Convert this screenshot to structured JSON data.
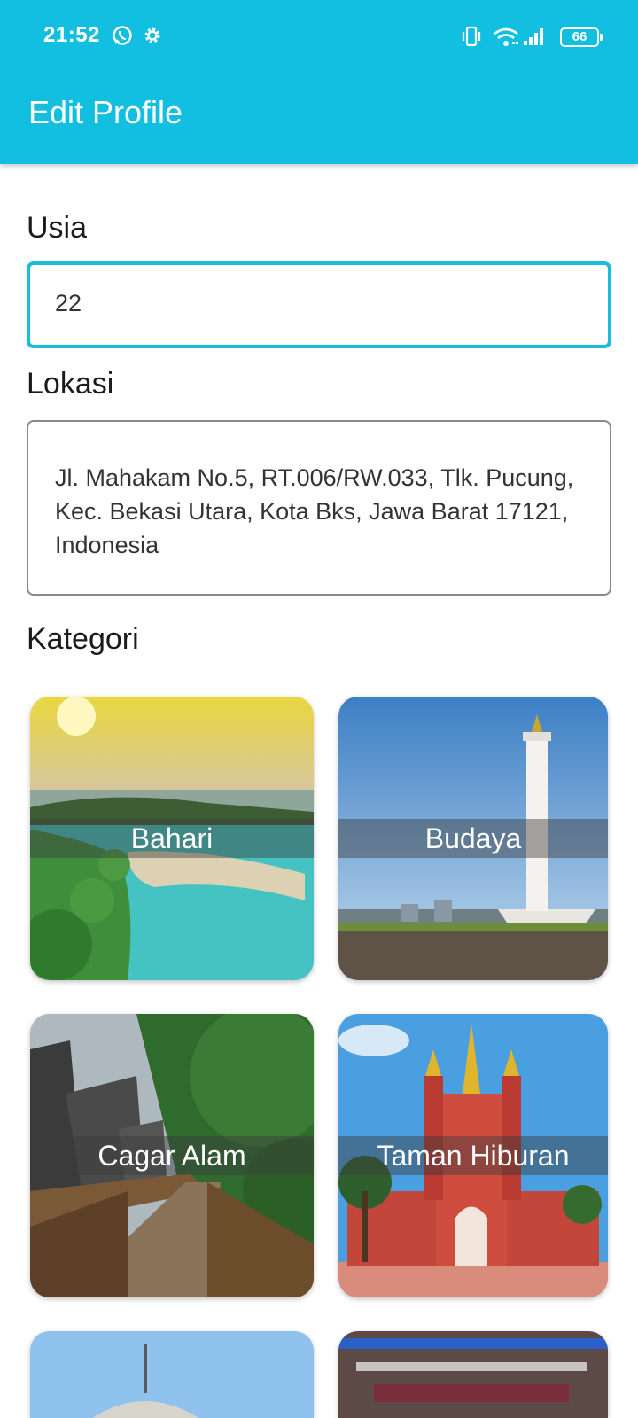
{
  "status_bar": {
    "time": "21:52",
    "battery": "66",
    "icons": [
      "whatsapp-icon",
      "settings-icon",
      "vibrate-icon",
      "wifi-icon",
      "signal-icon",
      "battery-icon"
    ]
  },
  "app_bar": {
    "title": "Edit Profile"
  },
  "form": {
    "age_label": "Usia",
    "age_value": "22",
    "location_label": "Lokasi",
    "location_value": "Jl. Mahakam No.5, RT.006/RW.033, Tlk. Pucung, Kec. Bekasi Utara, Kota Bks, Jawa Barat 17121, Indonesia",
    "category_label": "Kategori"
  },
  "categories": [
    {
      "label": "Bahari"
    },
    {
      "label": "Budaya"
    },
    {
      "label": "Cagar Alam"
    },
    {
      "label": "Taman Hiburan"
    }
  ],
  "colors": {
    "primary": "#12bfe0",
    "focus_border": "#1bbcd9"
  }
}
